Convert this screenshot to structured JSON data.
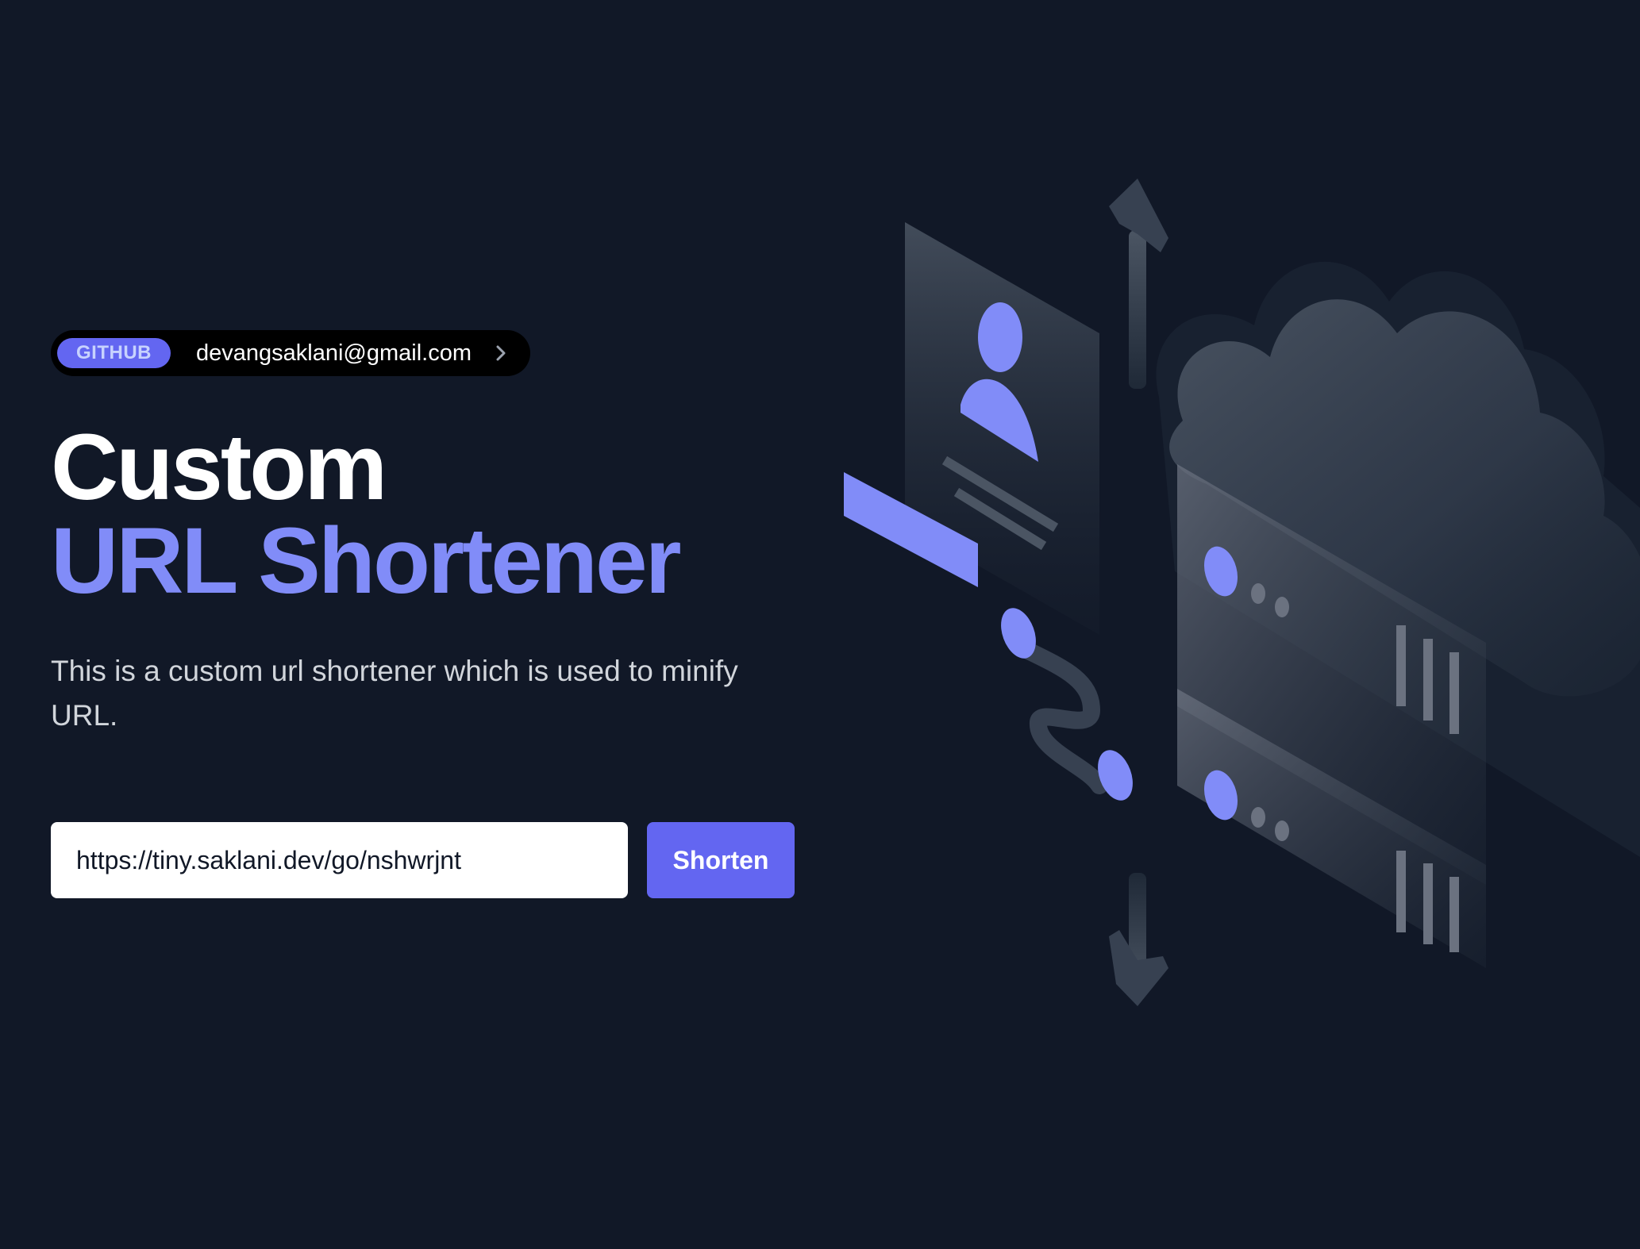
{
  "badge": {
    "tag": "GITHUB",
    "text": "devangsaklani@gmail.com",
    "icon": "chevron-right-icon"
  },
  "hero": {
    "title_line1": "Custom",
    "title_line2": "URL Shortener",
    "description": "This is a custom url shortener which is used to minify URL."
  },
  "form": {
    "url_value": "https://tiny.saklani.dev/go/nshwrjnt",
    "button_label": "Shorten"
  },
  "colors": {
    "background": "#111827",
    "accent": "#6366f1",
    "accent_light": "#818cf8",
    "text_primary": "#ffffff",
    "text_secondary": "#d1d5db"
  },
  "illustration": {
    "icons": [
      "cloud-icon",
      "server-icon",
      "user-profile-icon",
      "arrow-up-icon",
      "arrow-down-icon",
      "connection-link-icon"
    ]
  }
}
